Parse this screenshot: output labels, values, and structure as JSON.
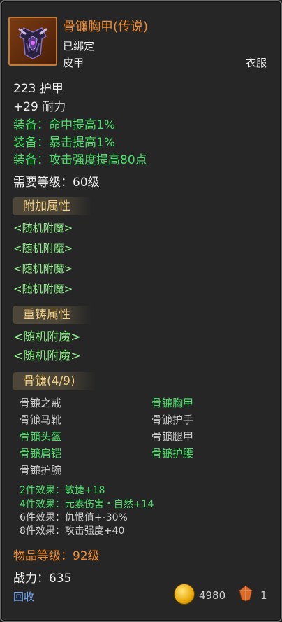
{
  "item": {
    "name": "骨镰胸甲(传说)",
    "bind": "已绑定",
    "type": "皮甲",
    "slot": "衣服",
    "icon": "bone-scythe-chest-armor-icon"
  },
  "stats": {
    "armor": "223 护甲",
    "stamina": "+29 耐力",
    "equip": [
      "装备：命中提高1%",
      "装备：暴击提高1%",
      "装备：攻击强度提高80点"
    ],
    "level_req": "需要等级：60级"
  },
  "extra": {
    "header": "附加属性",
    "items": [
      "<随机附魔>",
      "<随机附魔>",
      "<随机附魔>",
      "<随机附魔>"
    ]
  },
  "reforge": {
    "header": "重铸属性",
    "items": [
      "<随机附魔>",
      "<随机附魔>"
    ]
  },
  "set": {
    "header": "骨镰(4/9)",
    "pieces": [
      {
        "name": "骨镰之戒",
        "owned": false
      },
      {
        "name": "骨镰胸甲",
        "owned": true
      },
      {
        "name": "骨镰马靴",
        "owned": false
      },
      {
        "name": "骨镰护手",
        "owned": false
      },
      {
        "name": "骨镰头盔",
        "owned": true
      },
      {
        "name": "骨镰腿甲",
        "owned": false
      },
      {
        "name": "骨镰肩铠",
        "owned": true
      },
      {
        "name": "骨镰护腰",
        "owned": true
      },
      {
        "name": "骨镰护腕",
        "owned": false
      }
    ],
    "bonuses": [
      {
        "text": "2件效果：敏捷+18",
        "active": true
      },
      {
        "text": "4件效果：元素伤害・自然+14",
        "active": true
      },
      {
        "text": "6件效果：仇恨值+-30%",
        "active": false
      },
      {
        "text": "8件效果：攻击强度+40",
        "active": false
      }
    ]
  },
  "item_level": "物品等级：92级",
  "combat_power": "战力：635",
  "footer": {
    "recycle": "回收",
    "gold": "4980",
    "gem": "1",
    "gold_icon": "gold-coin-icon",
    "gem_icon": "red-gem-icon"
  },
  "colors": {
    "title": "#f28c2e",
    "equip_green": "#49e06a",
    "section_header": "#f2cf84",
    "link_blue": "#6fa8ff"
  }
}
